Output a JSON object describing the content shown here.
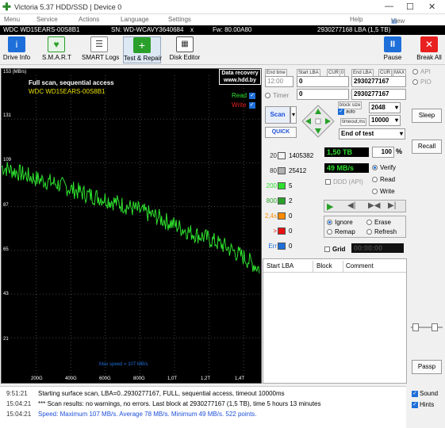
{
  "window": {
    "title": "Victoria 5.37 HDD/SSD | Device 0"
  },
  "menu": [
    "Menu",
    "Service",
    "Actions",
    "Language",
    "Settings",
    "Help",
    "View Buffer Live"
  ],
  "info": {
    "model": "WDC WD15EARS-00S8B1",
    "serial": "SN: WD-WCAVY3640684",
    "close_x": "x",
    "fw": "Fw: 80.00A80",
    "lba": "2930277168 LBA (1,5 TB)"
  },
  "toolbar": {
    "drive_info": "Drive Info",
    "smart": "S.M.A.R.T",
    "smart_logs": "SMART Logs",
    "test_repair": "Test & Repair",
    "disk_editor": "Disk Editor",
    "pause": "Pause",
    "break_all": "Break All"
  },
  "graph": {
    "unit": "153 (MB/s)",
    "y_ticks": [
      "131",
      "109",
      "87",
      "65",
      "43",
      "21"
    ],
    "x_ticks": [
      "200G",
      "400G",
      "600G",
      "800G",
      "1,0T",
      "1,2T",
      "1,4T"
    ],
    "title": "Full scan, sequential access",
    "model": "WDC WD15EARS-00S8B1",
    "recovery_line1": "Data recovery",
    "recovery_line2": "www.hdd.by",
    "read_label": "Read",
    "write_label": "Write",
    "max_speed": "Max speed = 107 MB/s"
  },
  "chart_data": {
    "type": "line",
    "x": [
      0,
      100,
      200,
      300,
      400,
      500,
      600,
      700,
      800,
      900,
      1000,
      1100,
      1200,
      1300,
      1400,
      1500
    ],
    "series": [
      {
        "values": [
          107,
          104,
          101,
          99,
          96,
          93,
          91,
          88,
          85,
          82,
          78,
          74,
          71,
          67,
          62,
          56
        ]
      }
    ],
    "ylim": [
      0,
      153
    ],
    "ylabel": "(MB/s)",
    "x_tick_labels": [
      "200G",
      "400G",
      "600G",
      "800G",
      "1,0T",
      "1,2T",
      "1,4T"
    ]
  },
  "controls": {
    "end_time": "End time",
    "start_lba": "Start LBA",
    "cur": "CUR",
    "zero": "0",
    "end_lba": "End LBA",
    "max": "MAX",
    "time_value": "12:00",
    "start_value": "0",
    "end_value": "2930277167",
    "timer": "Timer",
    "timer_value": "0",
    "end_value2": "2930277167",
    "scan": "Scan",
    "quick": "QUICK",
    "block_size": "block size",
    "auto": "auto",
    "block_value": "2048",
    "timeout": "timeout,ms",
    "timeout_value": "10000",
    "end_of_test": "End of test",
    "api": "API",
    "pio": "PIO",
    "sleep": "Sleep",
    "recall": "Recall",
    "passp": "Passp"
  },
  "blocks": [
    {
      "label": "20",
      "count": "1405382",
      "color": "#f4f4f4"
    },
    {
      "label": "80",
      "count": "25412",
      "color": "#b0b0b0"
    },
    {
      "label": "200",
      "count": "5",
      "color": "#2ee02e"
    },
    {
      "label": "800",
      "count": "2",
      "color": "#2aa02a"
    },
    {
      "label": "2,4s",
      "count": "0",
      "color": "#ff8c00"
    },
    {
      "label": ">",
      "count": "0",
      "color": "#e81010"
    },
    {
      "label": "Err",
      "count": "0",
      "color": "#1e6fd9"
    }
  ],
  "stats": {
    "size": "1,50 TB",
    "percent": "100",
    "pct_sign": "%",
    "speed": "49 MB/s",
    "ddd": "DDD (API)",
    "verify": "Verify",
    "read": "Read",
    "write": "Write",
    "ignore": "Ignore",
    "erase": "Erase",
    "remap": "Remap",
    "refresh": "Refresh",
    "grid": "Grid",
    "timer_lcd": "00:00:00"
  },
  "log_table": {
    "headers": [
      "Start LBA",
      "Block",
      "Comment"
    ]
  },
  "right": {
    "sound": "Sound",
    "hints": "Hints"
  },
  "log": [
    {
      "time": "9:51:21",
      "msg": "Starting surface scan, LBA=0..2930277167, FULL, sequential access, timeout 10000ms",
      "color": "#000"
    },
    {
      "time": "15:04:21",
      "msg": "*** Scan results: no warnings, no errors. Last block at 2930277167 (1,5 TB), time 5 hours 13 minutes",
      "color": "#000"
    },
    {
      "time": "15:04:21",
      "msg": "Speed: Maximum 107 MB/s. Average 78 MB/s. Minimum 49 MB/s. 522 points.",
      "color": "#1e4fd9"
    }
  ],
  "colors": {
    "graph_line": "#2ee02e",
    "title_yellow": "#e8e000",
    "accent": "#1e6fd9"
  }
}
